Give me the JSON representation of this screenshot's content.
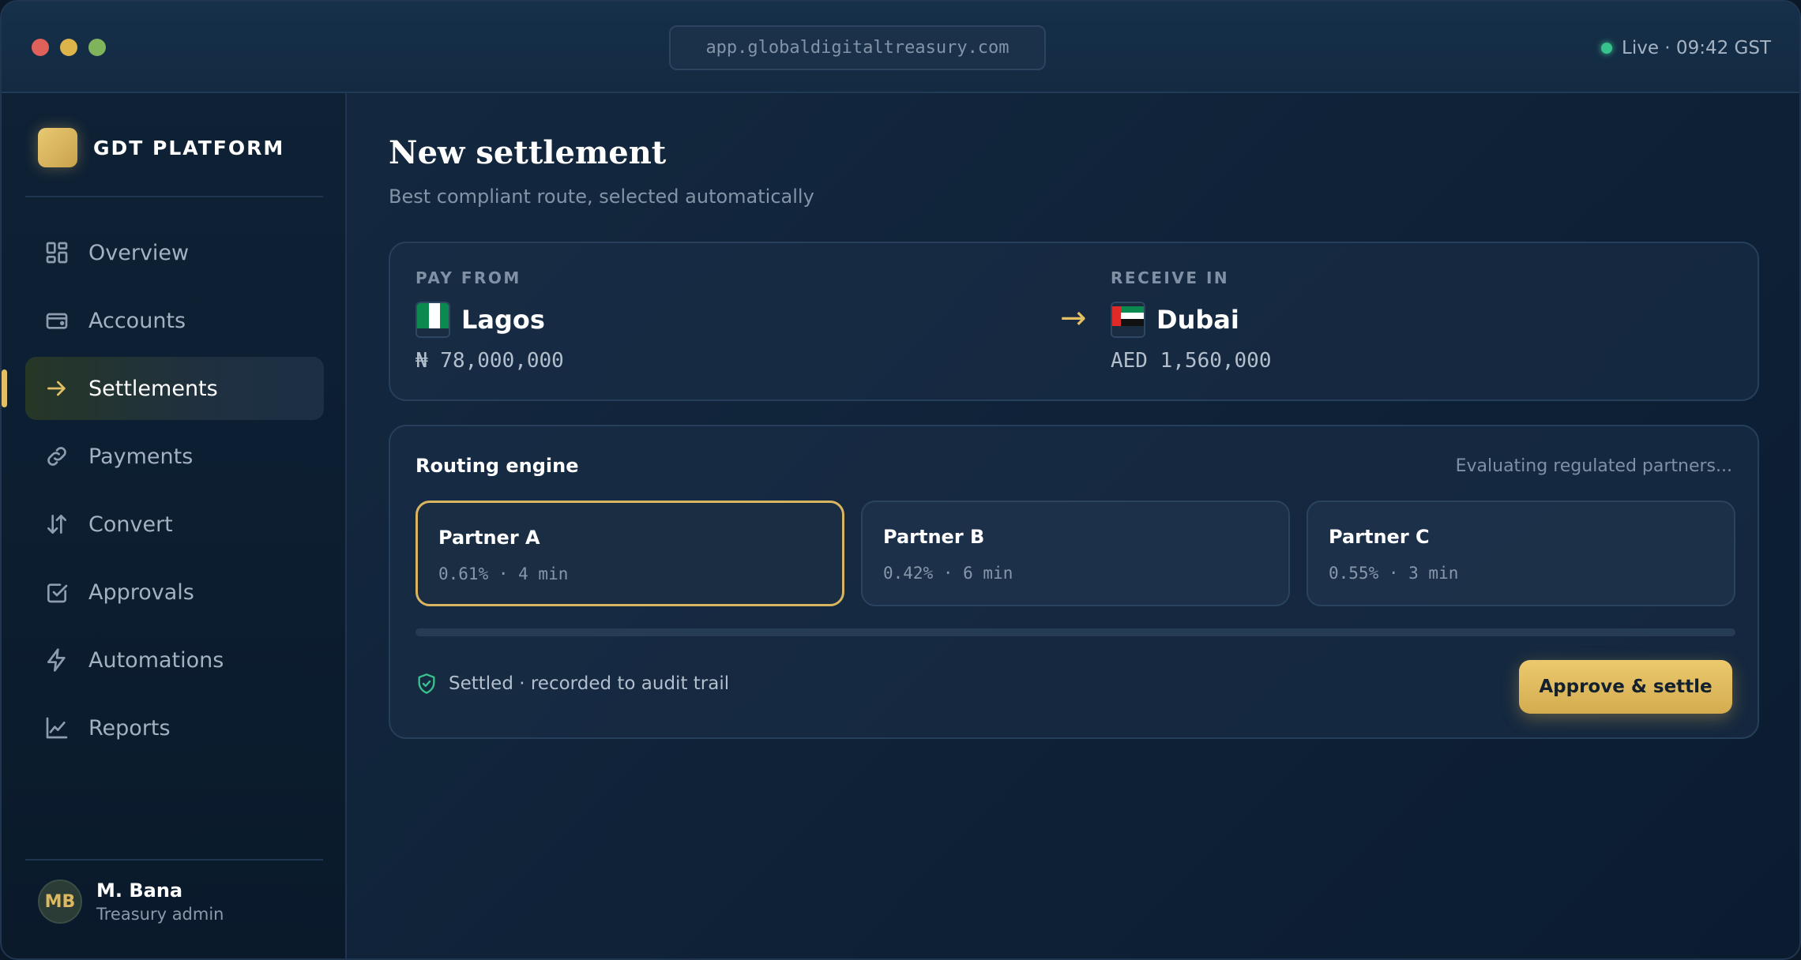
{
  "window": {
    "url": "app.globaldigitaltreasury.com",
    "live_status": "Live · 09:42 GST"
  },
  "sidebar": {
    "brand": "GDT PLATFORM",
    "items": [
      {
        "label": "Overview",
        "icon": "grid-icon"
      },
      {
        "label": "Accounts",
        "icon": "wallet-icon"
      },
      {
        "label": "Settlements",
        "icon": "arrow-right-icon",
        "active": true
      },
      {
        "label": "Payments",
        "icon": "link-icon"
      },
      {
        "label": "Convert",
        "icon": "swap-arrows-icon"
      },
      {
        "label": "Approvals",
        "icon": "checkbox-icon"
      },
      {
        "label": "Automations",
        "icon": "lightning-icon"
      },
      {
        "label": "Reports",
        "icon": "line-chart-icon"
      }
    ],
    "user": {
      "initials": "MB",
      "name": "M. Bana",
      "role": "Treasury admin"
    }
  },
  "main": {
    "title": "New settlement",
    "subtitle": "Best compliant route, selected automatically",
    "transfer": {
      "from": {
        "label": "PAY FROM",
        "city": "Lagos",
        "amount": "₦ 78,000,000",
        "flag": "nigeria-flag"
      },
      "arrow": "→",
      "to": {
        "label": "RECEIVE IN",
        "city": "Dubai",
        "amount": "AED 1,560,000",
        "flag": "uae-flag"
      }
    },
    "routing": {
      "title": "Routing engine",
      "status": "Evaluating regulated partners...",
      "partners": [
        {
          "name": "Partner A",
          "meta": "0.61% · 4 min",
          "selected": true
        },
        {
          "name": "Partner B",
          "meta": "0.42% · 6 min",
          "selected": false
        },
        {
          "name": "Partner C",
          "meta": "0.55% · 3 min",
          "selected": false
        }
      ],
      "progress": 0,
      "audit_text": "Settled · recorded to audit trail",
      "approve_label": "Approve & settle"
    }
  },
  "colors": {
    "accent_gold": "#e2bf65",
    "live_green": "#38c28c",
    "background": "#0f2238"
  }
}
